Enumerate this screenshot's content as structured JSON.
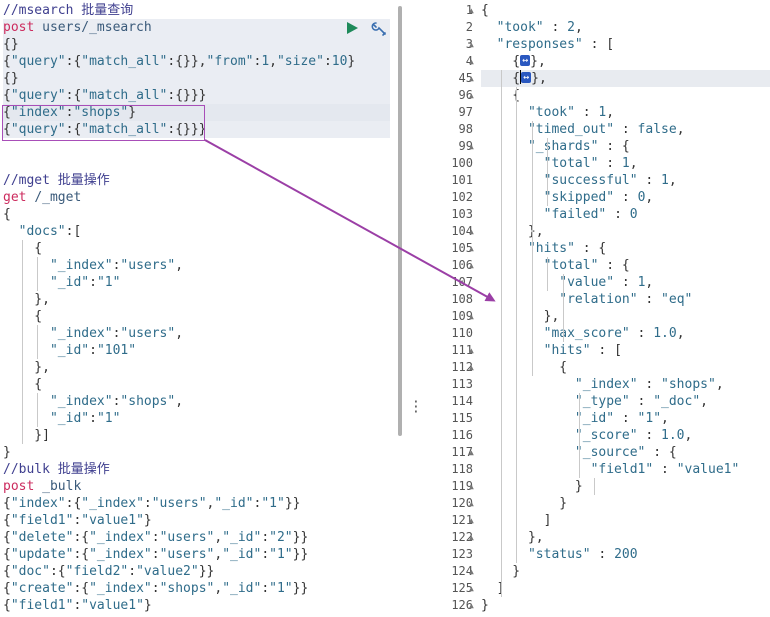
{
  "left_lines": [
    {
      "parts": [
        [
          "cm",
          "//msearch 批量查询"
        ]
      ]
    },
    {
      "parts": [
        [
          "kw",
          "post "
        ],
        [
          "url",
          "users/_msearch"
        ]
      ],
      "hl": true
    },
    {
      "parts": [
        [
          "p",
          "{}"
        ]
      ],
      "hl": true
    },
    {
      "parts": [
        [
          "p",
          "{"
        ],
        [
          "k",
          "\"query\""
        ],
        [
          "p",
          ":{"
        ],
        [
          "k",
          "\"match_all\""
        ],
        [
          "p",
          ":{}},"
        ],
        [
          "k",
          "\"from\""
        ],
        [
          "p",
          ":"
        ],
        [
          "n",
          "1"
        ],
        [
          "p",
          ","
        ],
        [
          "k",
          "\"size\""
        ],
        [
          "p",
          ":"
        ],
        [
          "n",
          "10"
        ],
        [
          "p",
          "}"
        ]
      ],
      "hl": true
    },
    {
      "parts": [
        [
          "p",
          "{}"
        ]
      ],
      "hl": true
    },
    {
      "parts": [
        [
          "p",
          "{"
        ],
        [
          "k",
          "\"query\""
        ],
        [
          "p",
          ":{"
        ],
        [
          "k",
          "\"match_all\""
        ],
        [
          "p",
          ":{}}}"
        ]
      ],
      "hl": true
    },
    {
      "parts": [
        [
          "p",
          "{"
        ],
        [
          "k",
          "\"index\""
        ],
        [
          "p",
          ":"
        ],
        [
          "s",
          "\"shops\""
        ],
        [
          "p",
          "}"
        ]
      ],
      "cur": true
    },
    {
      "parts": [
        [
          "p",
          "{"
        ],
        [
          "k",
          "\"query\""
        ],
        [
          "p",
          ":{"
        ],
        [
          "k",
          "\"match_all\""
        ],
        [
          "p",
          ":{}}}"
        ]
      ],
      "hl": true
    },
    {
      "parts": []
    },
    {
      "parts": []
    },
    {
      "parts": [
        [
          "cm",
          "//mget 批量操作"
        ]
      ]
    },
    {
      "parts": [
        [
          "kw",
          "get "
        ],
        [
          "url",
          "/_mget"
        ]
      ]
    },
    {
      "parts": [
        [
          "p",
          "{"
        ]
      ]
    },
    {
      "parts": [
        [
          "p",
          "  "
        ],
        [
          "k",
          "\"docs\""
        ],
        [
          "p",
          ":["
        ]
      ]
    },
    {
      "parts": [
        [
          "p",
          "    {"
        ]
      ]
    },
    {
      "parts": [
        [
          "p",
          "      "
        ],
        [
          "k",
          "\"_index\""
        ],
        [
          "p",
          ":"
        ],
        [
          "s",
          "\"users\""
        ],
        [
          "p",
          ","
        ]
      ]
    },
    {
      "parts": [
        [
          "p",
          "      "
        ],
        [
          "k",
          "\"_id\""
        ],
        [
          "p",
          ":"
        ],
        [
          "s",
          "\"1\""
        ]
      ]
    },
    {
      "parts": [
        [
          "p",
          "    },"
        ]
      ]
    },
    {
      "parts": [
        [
          "p",
          "    {"
        ]
      ]
    },
    {
      "parts": [
        [
          "p",
          "      "
        ],
        [
          "k",
          "\"_index\""
        ],
        [
          "p",
          ":"
        ],
        [
          "s",
          "\"users\""
        ],
        [
          "p",
          ","
        ]
      ]
    },
    {
      "parts": [
        [
          "p",
          "      "
        ],
        [
          "k",
          "\"_id\""
        ],
        [
          "p",
          ":"
        ],
        [
          "s",
          "\"101\""
        ]
      ]
    },
    {
      "parts": [
        [
          "p",
          "    },"
        ]
      ]
    },
    {
      "parts": [
        [
          "p",
          "    {"
        ]
      ]
    },
    {
      "parts": [
        [
          "p",
          "      "
        ],
        [
          "k",
          "\"_index\""
        ],
        [
          "p",
          ":"
        ],
        [
          "s",
          "\"shops\""
        ],
        [
          "p",
          ","
        ]
      ]
    },
    {
      "parts": [
        [
          "p",
          "      "
        ],
        [
          "k",
          "\"_id\""
        ],
        [
          "p",
          ":"
        ],
        [
          "s",
          "\"1\""
        ]
      ]
    },
    {
      "parts": [
        [
          "p",
          "    }]"
        ]
      ]
    },
    {
      "parts": [
        [
          "p",
          "}"
        ]
      ]
    },
    {
      "parts": [
        [
          "cm",
          "//bulk 批量操作"
        ]
      ]
    },
    {
      "parts": [
        [
          "kw",
          "post "
        ],
        [
          "url",
          "_bulk"
        ]
      ]
    },
    {
      "parts": [
        [
          "p",
          "{"
        ],
        [
          "k",
          "\"index\""
        ],
        [
          "p",
          ":{"
        ],
        [
          "k",
          "\"_index\""
        ],
        [
          "p",
          ":"
        ],
        [
          "s",
          "\"users\""
        ],
        [
          "p",
          ","
        ],
        [
          "k",
          "\"_id\""
        ],
        [
          "p",
          ":"
        ],
        [
          "s",
          "\"1\""
        ],
        [
          "p",
          "}}"
        ]
      ]
    },
    {
      "parts": [
        [
          "p",
          "{"
        ],
        [
          "k",
          "\"field1\""
        ],
        [
          "p",
          ":"
        ],
        [
          "s",
          "\"value1\""
        ],
        [
          "p",
          "}"
        ]
      ]
    },
    {
      "parts": [
        [
          "p",
          "{"
        ],
        [
          "k",
          "\"delete\""
        ],
        [
          "p",
          ":{"
        ],
        [
          "k",
          "\"_index\""
        ],
        [
          "p",
          ":"
        ],
        [
          "s",
          "\"users\""
        ],
        [
          "p",
          ","
        ],
        [
          "k",
          "\"_id\""
        ],
        [
          "p",
          ":"
        ],
        [
          "s",
          "\"2\""
        ],
        [
          "p",
          "}}"
        ]
      ]
    },
    {
      "parts": [
        [
          "p",
          "{"
        ],
        [
          "k",
          "\"update\""
        ],
        [
          "p",
          ":{"
        ],
        [
          "k",
          "\"_index\""
        ],
        [
          "p",
          ":"
        ],
        [
          "s",
          "\"users\""
        ],
        [
          "p",
          ","
        ],
        [
          "k",
          "\"_id\""
        ],
        [
          "p",
          ":"
        ],
        [
          "s",
          "\"1\""
        ],
        [
          "p",
          "}}"
        ]
      ]
    },
    {
      "parts": [
        [
          "p",
          "{"
        ],
        [
          "k",
          "\"doc\""
        ],
        [
          "p",
          ":{"
        ],
        [
          "k",
          "\"field2\""
        ],
        [
          "p",
          ":"
        ],
        [
          "s",
          "\"value2\""
        ],
        [
          "p",
          "}}"
        ]
      ]
    },
    {
      "parts": [
        [
          "p",
          "{"
        ],
        [
          "k",
          "\"create\""
        ],
        [
          "p",
          ":{"
        ],
        [
          "k",
          "\"_index\""
        ],
        [
          "p",
          ":"
        ],
        [
          "s",
          "\"shops\""
        ],
        [
          "p",
          ","
        ],
        [
          "k",
          "\"_id\""
        ],
        [
          "p",
          ":"
        ],
        [
          "s",
          "\"1\""
        ],
        [
          "p",
          "}}"
        ]
      ]
    },
    {
      "parts": [
        [
          "p",
          "{"
        ],
        [
          "k",
          "\"field1\""
        ],
        [
          "p",
          ":"
        ],
        [
          "s",
          "\"value1\""
        ],
        [
          "p",
          "}"
        ]
      ]
    }
  ],
  "right_lines": [
    {
      "no": "1",
      "fold": true,
      "parts": [
        [
          "p",
          "{"
        ]
      ]
    },
    {
      "no": "2",
      "parts": [
        [
          "p",
          "  "
        ],
        [
          "k",
          "\"took\""
        ],
        [
          "p",
          " : "
        ],
        [
          "n",
          "2"
        ],
        [
          "p",
          ","
        ]
      ]
    },
    {
      "no": "3",
      "fold": true,
      "parts": [
        [
          "p",
          "  "
        ],
        [
          "k",
          "\"responses\""
        ],
        [
          "p",
          " : ["
        ]
      ]
    },
    {
      "no": "4",
      "fold": true,
      "parts": [
        [
          "p",
          "    {"
        ],
        [
          "box",
          "↔"
        ],
        [
          "p",
          "},"
        ]
      ]
    },
    {
      "no": "45",
      "fold": true,
      "sel": true,
      "parts": [
        [
          "p",
          "    {"
        ],
        [
          "box",
          "↔"
        ],
        [
          "p",
          "},"
        ]
      ]
    },
    {
      "no": "96",
      "fold": true,
      "parts": [
        [
          "p",
          "    {"
        ]
      ]
    },
    {
      "no": "97",
      "parts": [
        [
          "p",
          "      "
        ],
        [
          "k",
          "\"took\""
        ],
        [
          "p",
          " : "
        ],
        [
          "n",
          "1"
        ],
        [
          "p",
          ","
        ]
      ]
    },
    {
      "no": "98",
      "parts": [
        [
          "p",
          "      "
        ],
        [
          "k",
          "\"timed_out\""
        ],
        [
          "p",
          " : "
        ],
        [
          "b",
          "false"
        ],
        [
          "p",
          ","
        ]
      ]
    },
    {
      "no": "99",
      "fold": true,
      "parts": [
        [
          "p",
          "      "
        ],
        [
          "k",
          "\"_shards\""
        ],
        [
          "p",
          " : {"
        ]
      ]
    },
    {
      "no": "100",
      "parts": [
        [
          "p",
          "        "
        ],
        [
          "k",
          "\"total\""
        ],
        [
          "p",
          " : "
        ],
        [
          "n",
          "1"
        ],
        [
          "p",
          ","
        ]
      ]
    },
    {
      "no": "101",
      "parts": [
        [
          "p",
          "        "
        ],
        [
          "k",
          "\"successful\""
        ],
        [
          "p",
          " : "
        ],
        [
          "n",
          "1"
        ],
        [
          "p",
          ","
        ]
      ]
    },
    {
      "no": "102",
      "parts": [
        [
          "p",
          "        "
        ],
        [
          "k",
          "\"skipped\""
        ],
        [
          "p",
          " : "
        ],
        [
          "n",
          "0"
        ],
        [
          "p",
          ","
        ]
      ]
    },
    {
      "no": "103",
      "parts": [
        [
          "p",
          "        "
        ],
        [
          "k",
          "\"failed\""
        ],
        [
          "p",
          " : "
        ],
        [
          "n",
          "0"
        ]
      ]
    },
    {
      "no": "104",
      "fold": true,
      "parts": [
        [
          "p",
          "      },"
        ]
      ]
    },
    {
      "no": "105",
      "fold": true,
      "parts": [
        [
          "p",
          "      "
        ],
        [
          "k",
          "\"hits\""
        ],
        [
          "p",
          " : {"
        ]
      ]
    },
    {
      "no": "106",
      "fold": true,
      "parts": [
        [
          "p",
          "        "
        ],
        [
          "k",
          "\"total\""
        ],
        [
          "p",
          " : {"
        ]
      ]
    },
    {
      "no": "107",
      "parts": [
        [
          "p",
          "          "
        ],
        [
          "k",
          "\"value\""
        ],
        [
          "p",
          " : "
        ],
        [
          "n",
          "1"
        ],
        [
          "p",
          ","
        ]
      ]
    },
    {
      "no": "108",
      "parts": [
        [
          "p",
          "          "
        ],
        [
          "k",
          "\"relation\""
        ],
        [
          "p",
          " : "
        ],
        [
          "s",
          "\"eq\""
        ]
      ]
    },
    {
      "no": "109",
      "fold": true,
      "parts": [
        [
          "p",
          "        },"
        ]
      ]
    },
    {
      "no": "110",
      "parts": [
        [
          "p",
          "        "
        ],
        [
          "k",
          "\"max_score\""
        ],
        [
          "p",
          " : "
        ],
        [
          "n",
          "1.0"
        ],
        [
          "p",
          ","
        ]
      ]
    },
    {
      "no": "111",
      "fold": true,
      "parts": [
        [
          "p",
          "        "
        ],
        [
          "k",
          "\"hits\""
        ],
        [
          "p",
          " : ["
        ]
      ]
    },
    {
      "no": "112",
      "fold": true,
      "parts": [
        [
          "p",
          "          {"
        ]
      ]
    },
    {
      "no": "113",
      "parts": [
        [
          "p",
          "            "
        ],
        [
          "k",
          "\"_index\""
        ],
        [
          "p",
          " : "
        ],
        [
          "s",
          "\"shops\""
        ],
        [
          "p",
          ","
        ]
      ]
    },
    {
      "no": "114",
      "parts": [
        [
          "p",
          "            "
        ],
        [
          "k",
          "\"_type\""
        ],
        [
          "p",
          " : "
        ],
        [
          "s",
          "\"_doc\""
        ],
        [
          "p",
          ","
        ]
      ]
    },
    {
      "no": "115",
      "parts": [
        [
          "p",
          "            "
        ],
        [
          "k",
          "\"_id\""
        ],
        [
          "p",
          " : "
        ],
        [
          "s",
          "\"1\""
        ],
        [
          "p",
          ","
        ]
      ]
    },
    {
      "no": "116",
      "parts": [
        [
          "p",
          "            "
        ],
        [
          "k",
          "\"_score\""
        ],
        [
          "p",
          " : "
        ],
        [
          "n",
          "1.0"
        ],
        [
          "p",
          ","
        ]
      ]
    },
    {
      "no": "117",
      "fold": true,
      "parts": [
        [
          "p",
          "            "
        ],
        [
          "k",
          "\"_source\""
        ],
        [
          "p",
          " : {"
        ]
      ]
    },
    {
      "no": "118",
      "parts": [
        [
          "p",
          "              "
        ],
        [
          "k",
          "\"field1\""
        ],
        [
          "p",
          " : "
        ],
        [
          "s",
          "\"value1\""
        ]
      ]
    },
    {
      "no": "119",
      "fold": true,
      "parts": [
        [
          "p",
          "            }"
        ]
      ]
    },
    {
      "no": "120",
      "fold": true,
      "parts": [
        [
          "p",
          "          }"
        ]
      ]
    },
    {
      "no": "121",
      "fold": true,
      "parts": [
        [
          "p",
          "        ]"
        ]
      ]
    },
    {
      "no": "122",
      "fold": true,
      "parts": [
        [
          "p",
          "      },"
        ]
      ]
    },
    {
      "no": "123",
      "parts": [
        [
          "p",
          "      "
        ],
        [
          "k",
          "\"status\""
        ],
        [
          "p",
          " : "
        ],
        [
          "n",
          "200"
        ]
      ]
    },
    {
      "no": "124",
      "fold": true,
      "parts": [
        [
          "p",
          "    }"
        ]
      ]
    },
    {
      "no": "125",
      "fold": true,
      "parts": [
        [
          "p",
          "  ]"
        ]
      ]
    },
    {
      "no": "126",
      "fold": true,
      "parts": [
        [
          "p",
          "}"
        ]
      ]
    }
  ],
  "icons": {
    "run": "play-icon",
    "wrench": "wrench-icon",
    "fold": "fold-arrow-icon",
    "grip": "drag-handle-icon"
  },
  "colors": {
    "comment": "#3f3f8f",
    "method": "#cc2b5e",
    "key": "#2f6c8a",
    "highlight_box": "#a84eb8",
    "fold_widget": "#2a58c0",
    "run_button": "#1e8a5a"
  }
}
